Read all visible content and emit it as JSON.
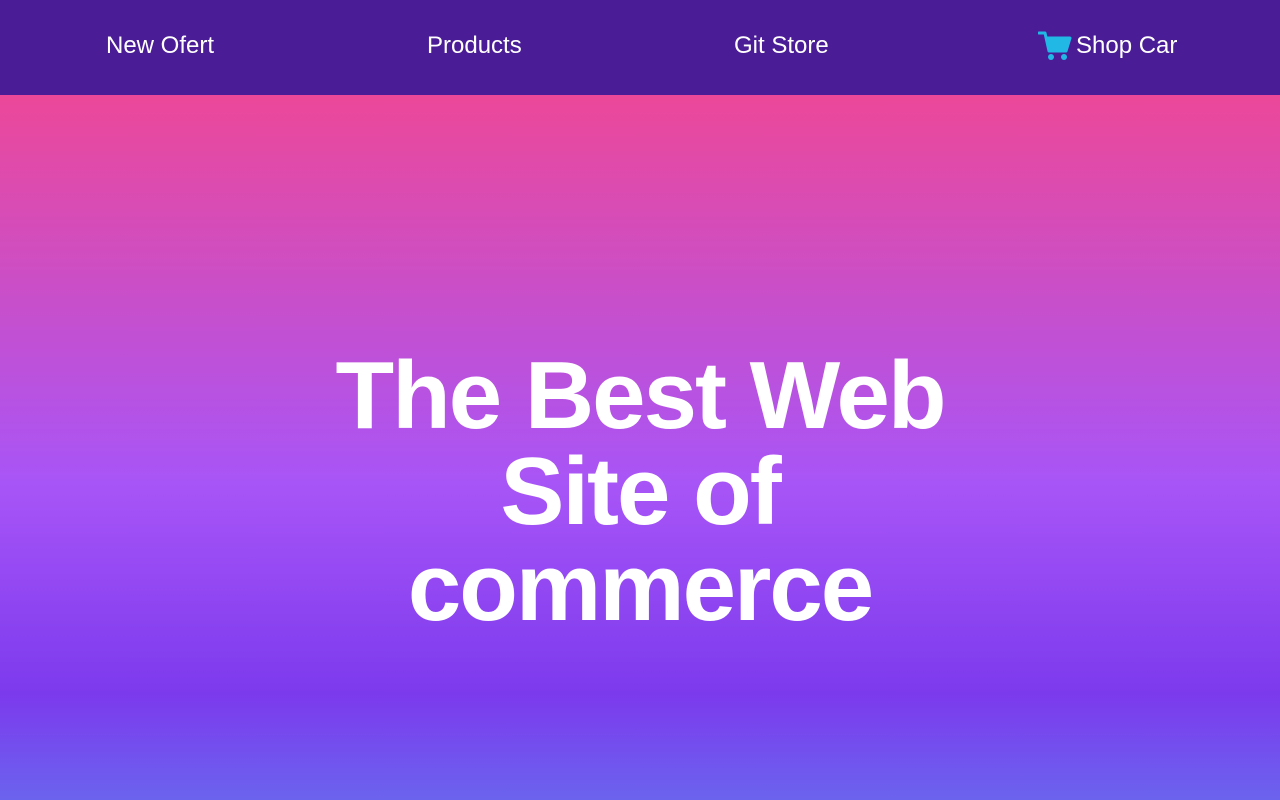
{
  "nav": {
    "items": [
      {
        "label": "New Ofert"
      },
      {
        "label": "Products"
      },
      {
        "label": "Git Store"
      },
      {
        "label": "Shop Car",
        "icon": "shopping-cart-icon"
      }
    ]
  },
  "hero": {
    "title": "The Best Web Site of commerce"
  },
  "colors": {
    "navbar": "#4a1c96",
    "cart_icon": "#22b8e6",
    "gradient_top": "#ec4899",
    "gradient_mid": "#a855f7",
    "gradient_bottom": "#6b63ee",
    "text": "#ffffff"
  }
}
